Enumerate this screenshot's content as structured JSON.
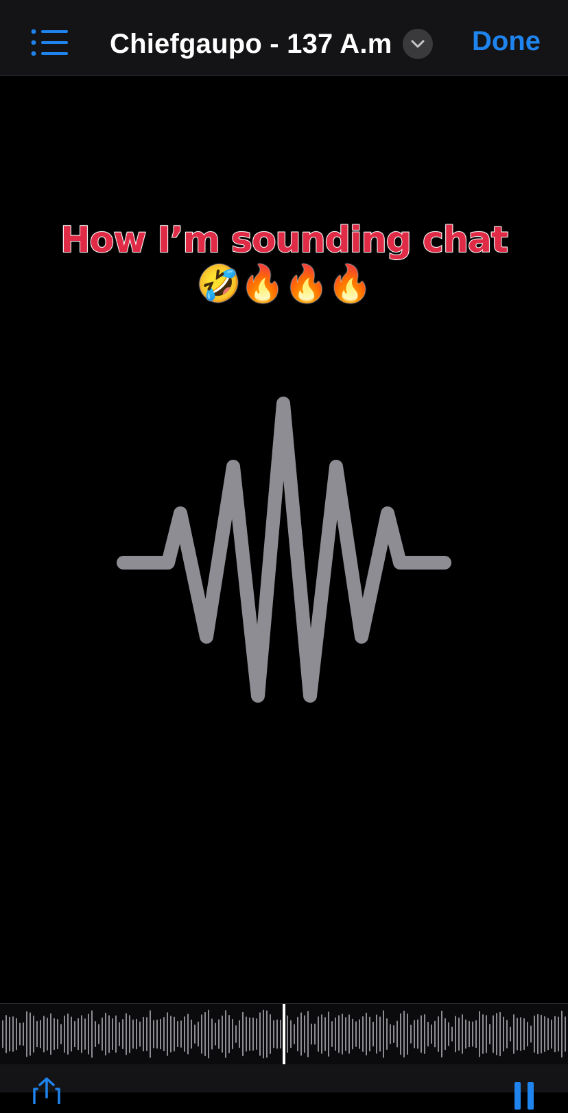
{
  "nav": {
    "title": "Chiefgaupo - 137 A.m",
    "done_label": "Done"
  },
  "caption": {
    "text": "How I’m sounding chat🤣🔥🔥🔥"
  },
  "icons": {
    "list": "list-bullet-icon",
    "title_menu": "chevron-down-icon",
    "waveform": "waveform-icon",
    "share": "share-icon",
    "pause": "pause-icon"
  },
  "playback": {
    "progress": 0.5
  },
  "colors": {
    "accent": "#1f84ee",
    "caption_fill": "#e02b47",
    "waveform": "#8e8d93"
  }
}
